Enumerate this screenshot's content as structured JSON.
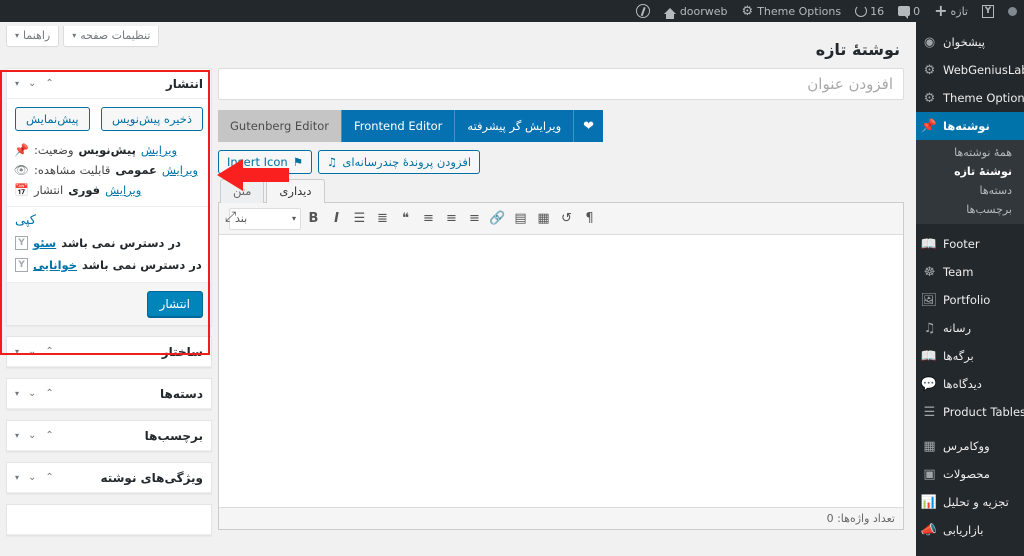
{
  "adminbar": {
    "site_name": "doorweb",
    "home_icon": "home-icon",
    "wp_logo": "wordpress-logo-icon",
    "theme_options": "Theme Options",
    "gear_icon": "gear-icon",
    "updates_count": "16",
    "updates_icon": "update-icon",
    "comments_count": "0",
    "comments_icon": "comment-icon",
    "new_label": "تازه",
    "plus_icon": "plus-icon",
    "yoast_icon": "yoast-icon",
    "dot_icon": "circle-icon"
  },
  "sidebar": {
    "items": [
      {
        "label": "پیشخوان",
        "icon": "dashboard-icon",
        "current": false
      },
      {
        "label": "WebGeniusLab",
        "icon": "flask-icon",
        "current": false
      },
      {
        "label": "Theme Options",
        "icon": "gear-icon",
        "current": false
      },
      {
        "label": "نوشته‌ها",
        "icon": "pin-icon",
        "current": true
      },
      {
        "label": "Footer",
        "icon": "book-icon",
        "current": false
      },
      {
        "label": "Team",
        "icon": "users-icon",
        "current": false
      },
      {
        "label": "Portfolio",
        "icon": "portfolio-icon",
        "current": false
      },
      {
        "label": "رسانه",
        "icon": "media-icon",
        "current": false
      },
      {
        "label": "برگه‌ها",
        "icon": "page-icon",
        "current": false
      },
      {
        "label": "دیدگاه‌ها",
        "icon": "comment-icon",
        "current": false
      },
      {
        "label": "Product Tables",
        "icon": "list-icon",
        "current": false
      },
      {
        "label": "ووکامرس",
        "icon": "woo-icon",
        "current": false
      },
      {
        "label": "محصولات",
        "icon": "products-icon",
        "current": false
      },
      {
        "label": "تجزیه و تحلیل",
        "icon": "chart-icon",
        "current": false
      },
      {
        "label": "بازاریابی",
        "icon": "megaphone-icon",
        "current": false
      }
    ],
    "submenu": [
      {
        "label": "همهٔ نوشته‌ها",
        "active": false
      },
      {
        "label": "نوشتهٔ تازه",
        "active": true
      },
      {
        "label": "دسته‌ها",
        "active": false
      },
      {
        "label": "برچسب‌ها",
        "active": false
      }
    ]
  },
  "screen_meta": {
    "help_label": "راهنما",
    "screen_options_label": "تنظیمات صفحه",
    "caret": "▾"
  },
  "page": {
    "title": "نوشتهٔ تازه",
    "title_placeholder": "افزودن عنوان"
  },
  "editor_switcher": {
    "heart_icon": "heart-icon",
    "advanced_label": "ویرایش گر پیشرفته",
    "frontend_label": "Frontend Editor",
    "gutenberg_label": "Gutenberg Editor"
  },
  "media_buttons": {
    "add_media_label": "افزودن پروندهٔ چندرسانه‌ای",
    "add_media_icon": "media-add-icon",
    "insert_icon_label": "Insert Icon",
    "insert_icon_glyph": "flag-icon"
  },
  "editor_tabs": [
    {
      "label": "دیداری",
      "active": true
    },
    {
      "label": "متن",
      "active": false
    }
  ],
  "editor_toolbar": {
    "format_value": "بند",
    "caret": "▾",
    "buttons": [
      {
        "name": "bold-icon",
        "glyph": "B"
      },
      {
        "name": "italic-icon",
        "glyph": "I"
      },
      {
        "name": "bullet-list-icon",
        "glyph": "☰"
      },
      {
        "name": "numbered-list-icon",
        "glyph": "≣"
      },
      {
        "name": "blockquote-icon",
        "glyph": "❝"
      },
      {
        "name": "align-right-icon",
        "glyph": "≡"
      },
      {
        "name": "align-center-icon",
        "glyph": "≡"
      },
      {
        "name": "align-left-icon",
        "glyph": "≡"
      },
      {
        "name": "link-icon",
        "glyph": "🔗"
      },
      {
        "name": "more-tag-icon",
        "glyph": "▤"
      },
      {
        "name": "keyboard-icon",
        "glyph": "▦"
      },
      {
        "name": "undo-icon",
        "glyph": "↺"
      },
      {
        "name": "rtl-icon",
        "glyph": "¶"
      }
    ],
    "fullscreen_icon": "fullscreen-icon",
    "fullscreen_glyph": "⤢"
  },
  "editor_status": {
    "word_count_label": "تعداد واژه‌ها: 0"
  },
  "publish_box": {
    "title": "انتشار",
    "save_draft_label": "ذخیره پیش‌نویس",
    "preview_label": "پیش‌نمایش",
    "status_label": "وضعیت:",
    "status_value": "پیش‌نویس",
    "status_edit": "ویرایش",
    "status_icon": "pin-icon",
    "visibility_label": "قابلیت مشاهده:",
    "visibility_value": "عمومی",
    "visibility_edit": "ویرایش",
    "visibility_icon": "eye-icon",
    "publish_label": "انتشار",
    "publish_when": "فوری",
    "publish_edit": "ویرایش",
    "publish_icon": "calendar-icon",
    "copy_label": "کپی",
    "seo_label": "سئو",
    "seo_value": "در دسترس نمی باشد",
    "readability_label": "خوانایی",
    "readability_value": "در دسترس نمی باشد",
    "publish_button_label": "انتشار"
  },
  "metaboxes": [
    {
      "title": "ساختار"
    },
    {
      "title": "دسته‌ها"
    },
    {
      "title": "برچسب‌ها"
    },
    {
      "title": "ویژگی‌های نوشته"
    },
    {
      "title": ""
    }
  ],
  "box_controls": {
    "up": "⌃",
    "down": "⌄",
    "toggle": "▾"
  },
  "annotation": {
    "highlight_color": "#f01d1d",
    "arrow_color": "#fb2020",
    "arrow_direction": "left"
  }
}
